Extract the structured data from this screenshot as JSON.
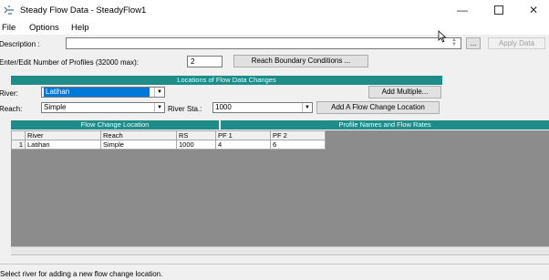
{
  "window": {
    "title": "Steady Flow Data - SteadyFlow1"
  },
  "menu": [
    "File",
    "Options",
    "Help"
  ],
  "description": {
    "label": "Description :",
    "value": ""
  },
  "apply_button": "Apply Data",
  "ellipsis_button": "...",
  "profiles": {
    "label": "Enter/Edit Number of Profiles (32000 max):",
    "value": "2"
  },
  "reach_boundary_button": "Reach Boundary Conditions ...",
  "locations_banner": "Locations of Flow Data Changes",
  "river": {
    "label": "River:",
    "value": "Latihan"
  },
  "reach": {
    "label": "Reach:",
    "value": "Simple"
  },
  "river_sta": {
    "label": "River Sta.:",
    "value": "1000"
  },
  "add_multiple_button": "Add Multiple...",
  "add_flow_location_button": "Add A Flow Change Location",
  "flow_change_banner": "Flow Change Location",
  "profile_names_banner": "Profile Names and Flow Rates",
  "table": {
    "headers": [
      "",
      "River",
      "Reach",
      "RS",
      "PF 1",
      "PF 2"
    ],
    "rows": [
      [
        "1",
        "Latihan",
        "Simple",
        "1000",
        "4",
        "6"
      ]
    ]
  },
  "status": "Select river for adding a new flow change location.",
  "colors": {
    "banner": "#1f8c8a",
    "selection": "#0078d7"
  }
}
